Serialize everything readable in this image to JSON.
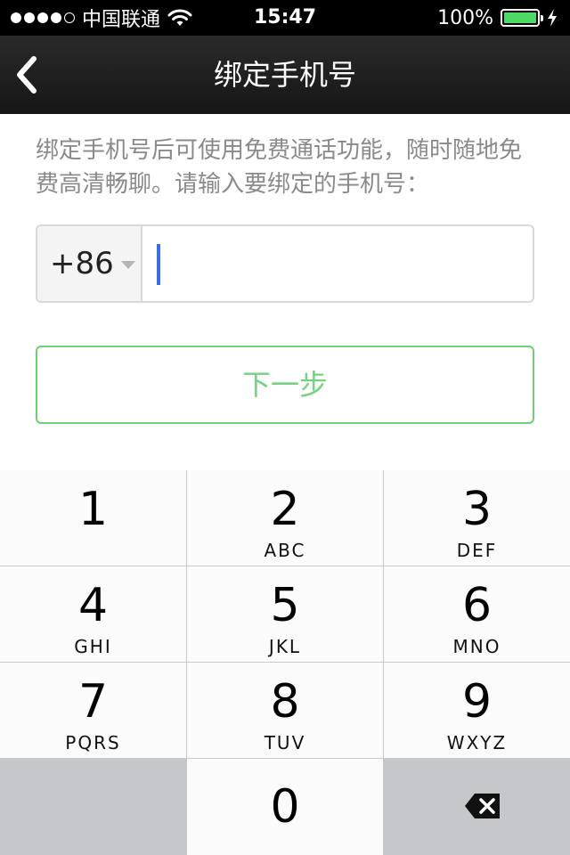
{
  "status_bar": {
    "carrier": "中国联通",
    "time": "15:47",
    "battery_percent": "100%",
    "signal_bars_filled": 4,
    "signal_bars_total": 5
  },
  "nav": {
    "title": "绑定手机号",
    "back_icon": "chevron-left-icon"
  },
  "content": {
    "description": "绑定手机号后可使用免费通话功能，随时随地免费高清畅聊。请输入要绑定的手机号：",
    "country_code": "+86",
    "phone_value": "",
    "next_button": "下一步"
  },
  "keypad": {
    "keys": [
      {
        "num": "1",
        "letters": ""
      },
      {
        "num": "2",
        "letters": "ABC"
      },
      {
        "num": "3",
        "letters": "DEF"
      },
      {
        "num": "4",
        "letters": "GHI"
      },
      {
        "num": "5",
        "letters": "JKL"
      },
      {
        "num": "6",
        "letters": "MNO"
      },
      {
        "num": "7",
        "letters": "PQRS"
      },
      {
        "num": "8",
        "letters": "TUV"
      },
      {
        "num": "9",
        "letters": "WXYZ"
      },
      {
        "num": "0",
        "letters": ""
      }
    ],
    "delete_icon": "backspace-icon"
  },
  "colors": {
    "accent_green": "#6fd07a",
    "caret_blue": "#3b6fe0",
    "battery_green": "#4cd964"
  }
}
